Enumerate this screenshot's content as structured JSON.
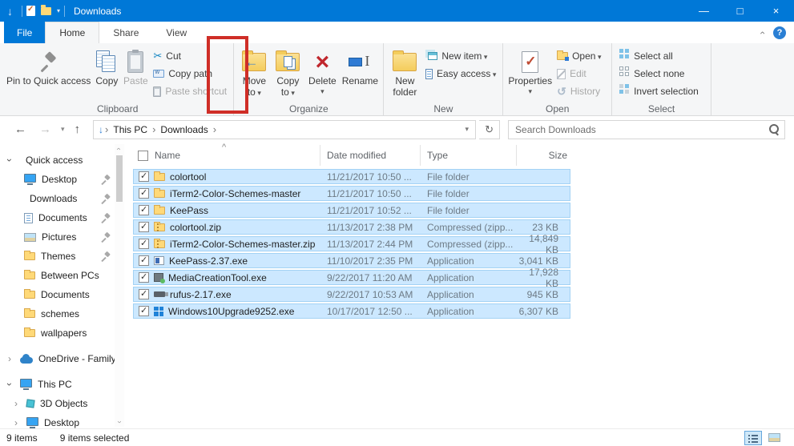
{
  "titlebar": {
    "title": "Downloads",
    "controls": {
      "minimize": "—",
      "maximize": "□",
      "close": "×"
    }
  },
  "tabs": {
    "file": "File",
    "home": "Home",
    "share": "Share",
    "view": "View",
    "help": "?"
  },
  "ribbon": {
    "clipboard": {
      "label": "Clipboard",
      "pin": "Pin to Quick access",
      "copy": "Copy",
      "paste": "Paste",
      "cut": "Cut",
      "copy_path": "Copy path",
      "paste_shortcut": "Paste shortcut"
    },
    "organize": {
      "label": "Organize",
      "move_to": "Move to",
      "copy_to": "Copy to",
      "delete": "Delete",
      "rename": "Rename"
    },
    "new": {
      "label": "New",
      "new_folder": "New folder",
      "new_item": "New item",
      "easy_access": "Easy access"
    },
    "open": {
      "label": "Open",
      "properties": "Properties",
      "open": "Open",
      "edit": "Edit",
      "history": "History"
    },
    "select": {
      "label": "Select",
      "select_all": "Select all",
      "select_none": "Select none",
      "invert_selection": "Invert selection"
    }
  },
  "addressbar": {
    "breadcrumb": [
      "This PC",
      "Downloads"
    ],
    "search_placeholder": "Search Downloads"
  },
  "sidebar": {
    "items": [
      {
        "label": "Quick access",
        "icon": "star",
        "level": 0,
        "expander": "down",
        "pinned": false,
        "gap": false
      },
      {
        "label": "Desktop",
        "icon": "monitor",
        "level": 1,
        "expander": "",
        "pinned": true,
        "gap": false
      },
      {
        "label": "Downloads",
        "icon": "download",
        "level": 1,
        "expander": "",
        "pinned": true,
        "gap": false
      },
      {
        "label": "Documents",
        "icon": "document",
        "level": 1,
        "expander": "",
        "pinned": true,
        "gap": false
      },
      {
        "label": "Pictures",
        "icon": "picture",
        "level": 1,
        "expander": "",
        "pinned": true,
        "gap": false
      },
      {
        "label": "Themes",
        "icon": "folder",
        "level": 1,
        "expander": "",
        "pinned": true,
        "gap": false
      },
      {
        "label": "Between PCs",
        "icon": "folder",
        "level": 1,
        "expander": "",
        "pinned": false,
        "gap": false
      },
      {
        "label": "Documents",
        "icon": "folder",
        "level": 1,
        "expander": "",
        "pinned": false,
        "gap": false
      },
      {
        "label": "schemes",
        "icon": "folder",
        "level": 1,
        "expander": "",
        "pinned": false,
        "gap": false
      },
      {
        "label": "wallpapers",
        "icon": "folder",
        "level": 1,
        "expander": "",
        "pinned": false,
        "gap": false
      },
      {
        "label": "OneDrive - Family",
        "icon": "cloud",
        "level": 0,
        "expander": "right",
        "pinned": false,
        "gap": true
      },
      {
        "label": "This PC",
        "icon": "monitor",
        "level": 0,
        "expander": "down",
        "pinned": false,
        "gap": true
      },
      {
        "label": "3D Objects",
        "icon": "cube",
        "level": 1,
        "expander": "right",
        "pinned": false,
        "gap": false
      },
      {
        "label": "Desktop",
        "icon": "monitor",
        "level": 1,
        "expander": "right",
        "pinned": false,
        "gap": false
      }
    ]
  },
  "files": {
    "columns": [
      "Name",
      "Date modified",
      "Type",
      "Size"
    ],
    "sort_caret": "^",
    "rows": [
      {
        "icon": "folder",
        "name": "colortool",
        "date": "11/21/2017 10:50 ...",
        "type": "File folder",
        "size": ""
      },
      {
        "icon": "folder",
        "name": "iTerm2-Color-Schemes-master",
        "date": "11/21/2017 10:50 ...",
        "type": "File folder",
        "size": ""
      },
      {
        "icon": "folder",
        "name": "KeePass",
        "date": "11/21/2017 10:52 ...",
        "type": "File folder",
        "size": ""
      },
      {
        "icon": "zip",
        "name": "colortool.zip",
        "date": "11/13/2017 2:38 PM",
        "type": "Compressed (zipp...",
        "size": "23 KB"
      },
      {
        "icon": "zip",
        "name": "iTerm2-Color-Schemes-master.zip",
        "date": "11/13/2017 2:44 PM",
        "type": "Compressed (zipp...",
        "size": "14,849 KB"
      },
      {
        "icon": "keepass",
        "name": "KeePass-2.37.exe",
        "date": "11/10/2017 2:35 PM",
        "type": "Application",
        "size": "3,041 KB"
      },
      {
        "icon": "media",
        "name": "MediaCreationTool.exe",
        "date": "9/22/2017 11:20 AM",
        "type": "Application",
        "size": "17,928 KB"
      },
      {
        "icon": "rufus",
        "name": "rufus-2.17.exe",
        "date": "9/22/2017 10:53 AM",
        "type": "Application",
        "size": "945 KB"
      },
      {
        "icon": "windows",
        "name": "Windows10Upgrade9252.exe",
        "date": "10/17/2017 12:50 ...",
        "type": "Application",
        "size": "6,307 KB"
      }
    ]
  },
  "statusbar": {
    "items_count": "9 items",
    "selected_count": "9 items selected"
  },
  "colors": {
    "accent": "#0078d7",
    "selection": "#cce8ff",
    "highlight": "#cf2e27"
  }
}
